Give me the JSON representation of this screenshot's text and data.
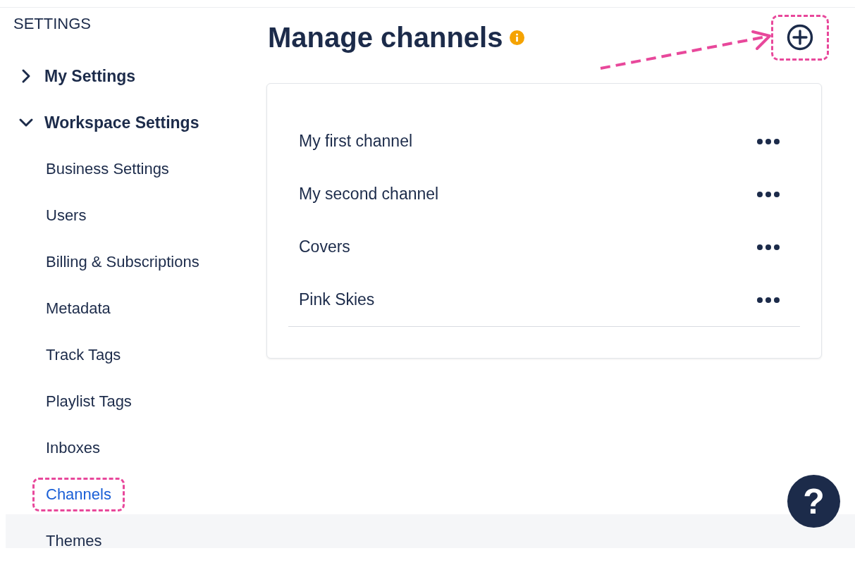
{
  "sidebar": {
    "title": "SETTINGS",
    "items": [
      {
        "label": "My Settings",
        "expanded": false
      },
      {
        "label": "Workspace Settings",
        "expanded": true,
        "children": [
          {
            "label": "Business Settings",
            "selected": false,
            "highlighted": false
          },
          {
            "label": "Users",
            "selected": false,
            "highlighted": false
          },
          {
            "label": "Billing & Subscriptions",
            "selected": false,
            "highlighted": false
          },
          {
            "label": "Metadata",
            "selected": false,
            "highlighted": false
          },
          {
            "label": "Track Tags",
            "selected": false,
            "highlighted": false
          },
          {
            "label": "Playlist Tags",
            "selected": false,
            "highlighted": false
          },
          {
            "label": "Inboxes",
            "selected": false,
            "highlighted": false
          },
          {
            "label": "Channels",
            "selected": true,
            "highlighted": true
          },
          {
            "label": "Themes",
            "selected": false,
            "highlighted": false
          }
        ]
      }
    ]
  },
  "header": {
    "title": "Manage channels",
    "add_button_highlighted": true
  },
  "channels": [
    {
      "name": "My first channel"
    },
    {
      "name": "My second channel"
    },
    {
      "name": "Covers"
    },
    {
      "name": "Pink Skies"
    }
  ],
  "help": {
    "label": "?"
  }
}
